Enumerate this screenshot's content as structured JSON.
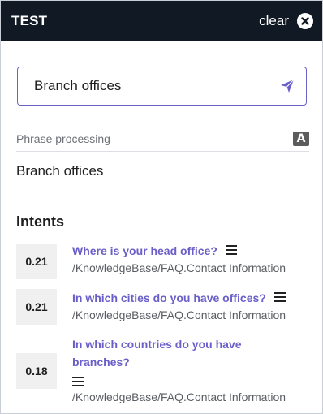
{
  "header": {
    "title": "TEST",
    "clear_label": "clear"
  },
  "search": {
    "value": "Branch offices"
  },
  "phrase": {
    "label": "Phrase processing",
    "text": "Branch offices",
    "icon_letter": "A"
  },
  "intents": {
    "title": "Intents",
    "items": [
      {
        "score": "0.21",
        "question": "Where is your head office?",
        "path": "/KnowledgeBase/FAQ.Contact Information"
      },
      {
        "score": "0.21",
        "question": "In which cities do you have offices?",
        "path": "/KnowledgeBase/FAQ.Contact Information"
      },
      {
        "score": "0.18",
        "question": "In which countries do you have branches?",
        "path": "/KnowledgeBase/FAQ.Contact Information"
      }
    ]
  },
  "colors": {
    "header_bg": "#111a24",
    "accent": "#6a5fc8",
    "border": "#6c63c7"
  }
}
